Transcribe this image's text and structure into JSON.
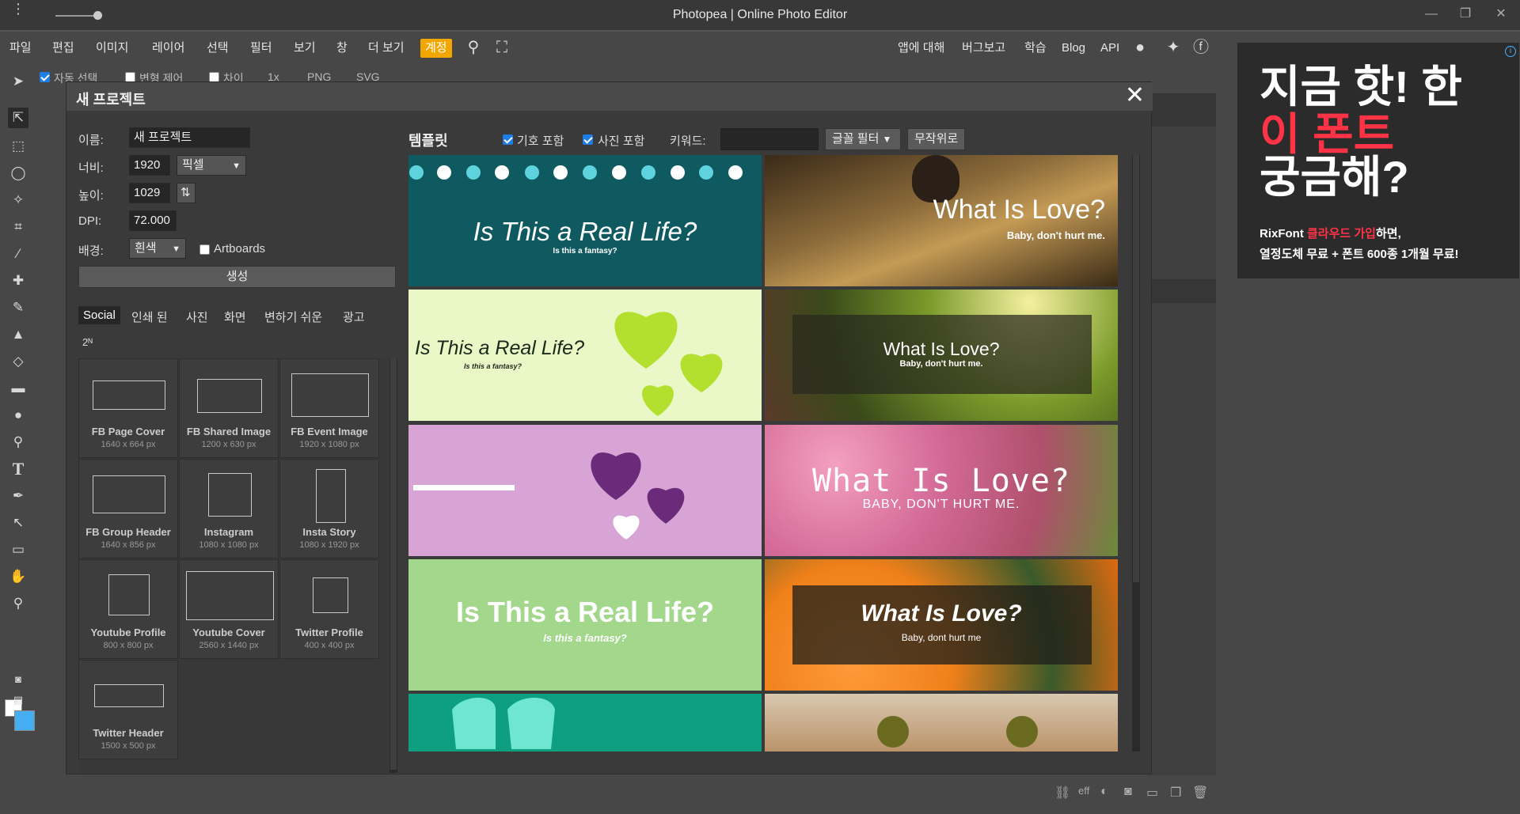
{
  "window": {
    "title": "Photopea | Online Photo Editor"
  },
  "menu": {
    "items": [
      "파일",
      "편집",
      "이미지",
      "레이어",
      "선택",
      "필터",
      "보기",
      "창",
      "더 보기"
    ],
    "account": "계정",
    "right": [
      "앱에 대해",
      "버그보고",
      "학습",
      "Blog",
      "API"
    ]
  },
  "options": {
    "auto_select": "자동 선택",
    "transform": "변형 제어",
    "distance": "차이",
    "zoom": "1x",
    "png": "PNG",
    "svg": "SVG"
  },
  "ad": {
    "line1": "지금 핫! 한",
    "line2": "이 폰트",
    "line3": "궁금해?",
    "sub1_a": "RixFont ",
    "sub1_b": "클라우드 가입",
    "sub1_c": "하면,",
    "sub2": "열정도체 무료 + 폰트 600종 1개월 무료!",
    "info": "i"
  },
  "dialog": {
    "title": "새 프로젝트",
    "close": "✕",
    "name_label": "이름:",
    "name_value": "새 프로젝트",
    "width_label": "너비:",
    "width_value": "1920",
    "unit": "픽셀",
    "height_label": "높이:",
    "height_value": "1029",
    "dpi_label": "DPI:",
    "dpi_value": "72.000",
    "bg_label": "배경:",
    "bg_value": "흰색",
    "artboards": "Artboards",
    "create": "생성",
    "categories": [
      "Social",
      "인쇄 된",
      "사진",
      "화면",
      "변하기 쉬운",
      "광고"
    ],
    "pow2": "2ᴺ",
    "presets": [
      {
        "name": "FB Page Cover",
        "size": "1640 x 664 px"
      },
      {
        "name": "FB Shared Image",
        "size": "1200 x 630 px"
      },
      {
        "name": "FB Event Image",
        "size": "1920 x 1080 px"
      },
      {
        "name": "FB Group Header",
        "size": "1640 x 856 px"
      },
      {
        "name": "Instagram",
        "size": "1080 x 1080 px"
      },
      {
        "name": "Insta Story",
        "size": "1080 x 1920 px"
      },
      {
        "name": "Youtube Profile",
        "size": "800 x 800 px"
      },
      {
        "name": "Youtube Cover",
        "size": "2560 x 1440 px"
      },
      {
        "name": "Twitter Profile",
        "size": "400 x 400 px"
      },
      {
        "name": "Twitter Header",
        "size": "1500 x 500 px"
      }
    ],
    "templates_label": "템플릿",
    "include_symbols": "기호 포함",
    "include_photos": "사진 포함",
    "keyword_label": "키워드:",
    "font_filter": "글꼴 필터",
    "random": "무작위로",
    "tiles": [
      {
        "title": "Is This a Real Life?",
        "sub": "Is this a fantasy?"
      },
      {
        "title": "What Is Love?",
        "sub": "Baby, don't hurt me."
      },
      {
        "title": "Is This a Real Life?",
        "sub": "Is this a fantasy?"
      },
      {
        "title": "What Is Love?",
        "sub": "Baby, don't hurt me."
      },
      {
        "title": "",
        "sub": ""
      },
      {
        "title": "What Is Love?",
        "sub": "BABY, DON'T HURT ME."
      },
      {
        "title": "Is This a Real Life?",
        "sub": "Is this a fantasy?"
      },
      {
        "title": "What Is Love?",
        "sub": "Baby, dont hurt me"
      }
    ]
  },
  "colors": {
    "accent": "#f1a600",
    "teal": "#0f5a60",
    "lime": "#eaf7c7",
    "pink": "#d8a4d6",
    "green": "#a3d78b",
    "foreground": "#ffffff",
    "background": "#44aef1"
  }
}
